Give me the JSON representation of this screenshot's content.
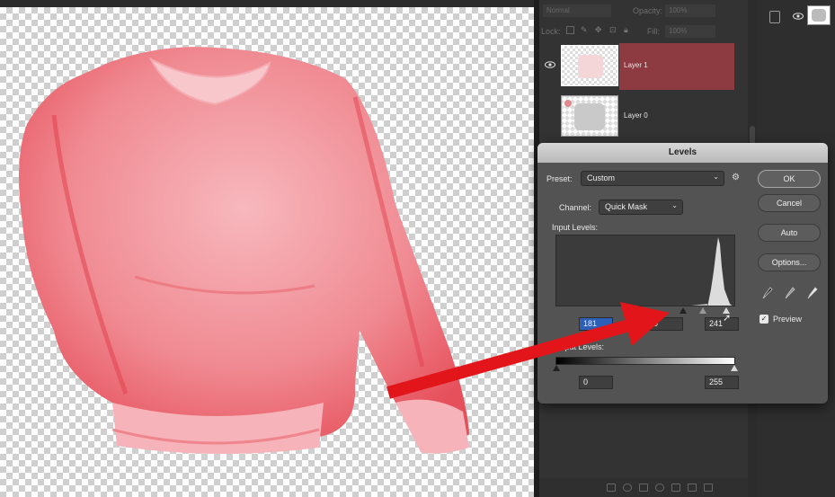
{
  "layers_panel": {
    "blend_mode": "Normal",
    "opacity_label": "Opacity:",
    "opacity_value": "100%",
    "lock_label": "Lock:",
    "fill_label": "Fill:",
    "fill_value": "100%",
    "layers": [
      {
        "name": "Layer 1",
        "selected": true,
        "visible": true
      },
      {
        "name": "Layer 0",
        "selected": false,
        "visible": false
      }
    ],
    "selected_color": "#8d3a40"
  },
  "levels_dialog": {
    "title": "Levels",
    "preset_label": "Preset:",
    "preset_value": "Custom",
    "channel_label": "Channel:",
    "channel_value": "Quick Mask",
    "input_levels_label": "Input Levels:",
    "input_black": "181",
    "input_mid": "0",
    "input_white": "241",
    "output_levels_label": "Output Levels:",
    "output_black": "0",
    "output_white": "255",
    "buttons": {
      "ok": "OK",
      "cancel": "Cancel",
      "auto": "Auto",
      "options": "Options..."
    },
    "preview_label": "Preview",
    "preview_checked": true
  },
  "colors": {
    "sweater": "#f0838a",
    "arrow": "#e2151b",
    "dialog_bg": "#535353"
  },
  "icons": [
    "eye-icon",
    "gear-icon",
    "black-eyedropper-icon",
    "gray-eyedropper-icon",
    "white-eyedropper-icon",
    "checkbox-icon"
  ]
}
